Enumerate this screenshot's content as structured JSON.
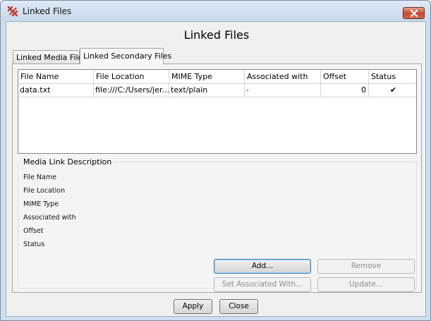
{
  "window": {
    "title": "Linked Files",
    "app_icon": "jigsaw-logo-icon",
    "close_icon": "close-icon",
    "close_color": "#c7442b"
  },
  "dialog": {
    "heading": "Linked Files"
  },
  "tabs": [
    {
      "label": "Linked Media Files",
      "selected": false
    },
    {
      "label": "Linked Secondary Files",
      "selected": true
    }
  ],
  "table": {
    "columns": [
      "File Name",
      "File Location",
      "MIME Type",
      "Associated with",
      "Offset",
      "Status"
    ],
    "rows": [
      {
        "file_name": "data.txt",
        "file_location": "file:///C:/Users/jer...",
        "mime_type": "text/plain",
        "associated_with": "-",
        "offset": "0",
        "status": "✔"
      }
    ]
  },
  "description": {
    "title": "Media Link Description",
    "labels": [
      "File Name",
      "File Location",
      "MIME Type",
      "Associated with",
      "Offset",
      "Status"
    ]
  },
  "buttons": {
    "add": "Add...",
    "remove": "Remove",
    "set_associated": "Set Associated With...",
    "update": "Update...",
    "apply": "Apply",
    "close": "Close"
  }
}
